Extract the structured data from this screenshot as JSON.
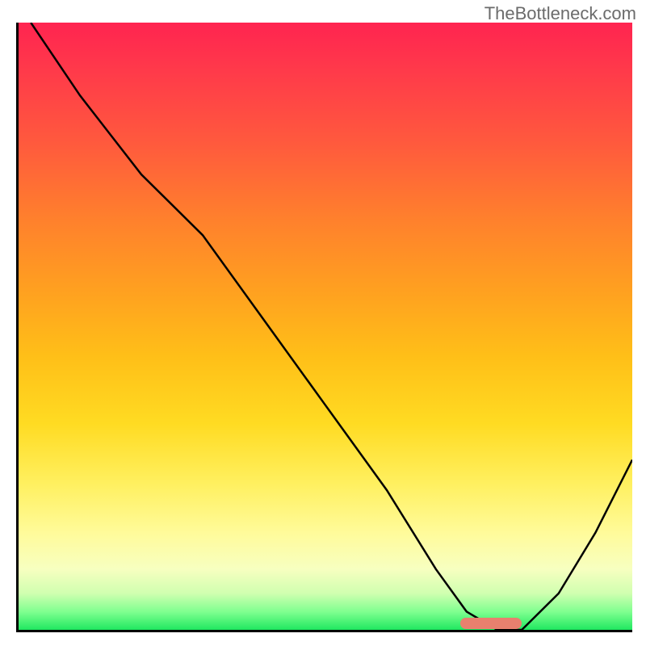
{
  "watermark": "TheBottleneck.com",
  "chart_data": {
    "type": "line",
    "title": "",
    "xlabel": "",
    "ylabel": "",
    "xlim": [
      0,
      100
    ],
    "ylim": [
      0,
      100
    ],
    "series": [
      {
        "name": "curve",
        "x": [
          2,
          10,
          20,
          30,
          40,
          50,
          60,
          68,
          73,
          78,
          82,
          88,
          94,
          100
        ],
        "y": [
          100,
          88,
          75,
          65,
          51,
          37,
          23,
          10,
          3,
          0,
          0,
          6,
          16,
          28
        ]
      }
    ],
    "marker": {
      "x_start": 72,
      "x_end": 82,
      "y": 0
    },
    "gradient_stops": [
      {
        "pos": 0,
        "color": "#ff2450"
      },
      {
        "pos": 20,
        "color": "#ff5a3d"
      },
      {
        "pos": 44,
        "color": "#ffa020"
      },
      {
        "pos": 66,
        "color": "#ffdb22"
      },
      {
        "pos": 84,
        "color": "#fffb9a"
      },
      {
        "pos": 97,
        "color": "#80ff90"
      },
      {
        "pos": 100,
        "color": "#20e860"
      }
    ]
  }
}
